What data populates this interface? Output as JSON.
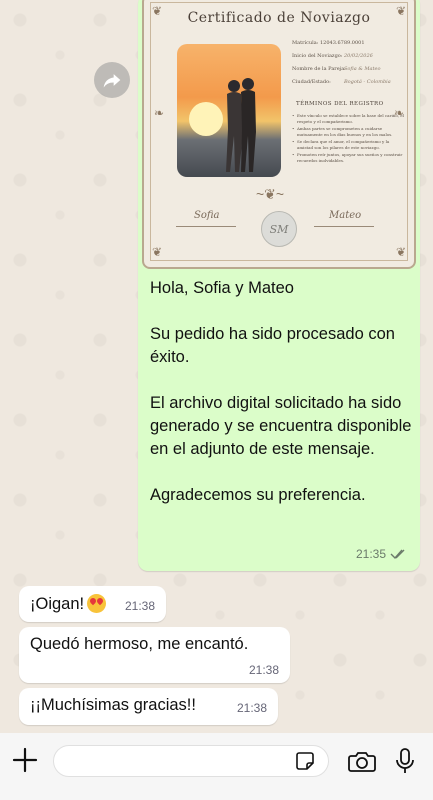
{
  "certificate": {
    "title": "Certificado de Noviazgo",
    "fields": [
      {
        "label": "Matrícula: 12043.6789.0001",
        "value": ""
      },
      {
        "label": "Inicio del Noviazgo:",
        "value": "20/02/2026"
      },
      {
        "label": "Nombre de la Pareja:",
        "value": "Sofia & Mateo"
      },
      {
        "label": "Ciudad/Estado:",
        "value": "Bogotá - Colombia"
      }
    ],
    "terms_title": "TÉRMINOS DEL REGISTRO",
    "terms": [
      "Este vínculo se establece sobre la base del cariño, el respeto y el compañerismo.",
      "Ambas partes se comprometen a cuidarse mutuamente en los días buenos y en los malos.",
      "Se declara que el amor, el compañerismo y la amistad son los pilares de este noviazgo.",
      "Promoten reír juntos, apoyar sus sueños y construir recuerdos inolvidables."
    ],
    "signature_left": "Sofia",
    "signature_right": "Mateo",
    "seal": "SM"
  },
  "outgoing": {
    "paragraphs": [
      "Hola, Sofia y Mateo",
      "Su pedido ha sido procesado con éxito.",
      "El archivo digital solicitado ha sido generado y se encuentra disponible en el adjunto de este mensaje.",
      "Agradecemos su preferencia."
    ],
    "time": "21:35",
    "status_icon": "double-check-icon"
  },
  "incoming": [
    {
      "text": "¡Oigan!",
      "emoji": "smiling-face-with-heart-eyes",
      "time": "21:38"
    },
    {
      "text": "Quedó hermoso, me encantó.",
      "time": "21:38"
    },
    {
      "text": "¡¡Muchísimas gracias!!",
      "time": "21:38"
    }
  ],
  "input": {
    "placeholder": "",
    "icons": [
      "plus-icon",
      "sticker-icon",
      "camera-icon",
      "microphone-icon"
    ]
  },
  "colors": {
    "outgoing_bubble": "#dbfdc9",
    "incoming_bubble": "#ffffff",
    "chat_background": "#efe8df"
  }
}
